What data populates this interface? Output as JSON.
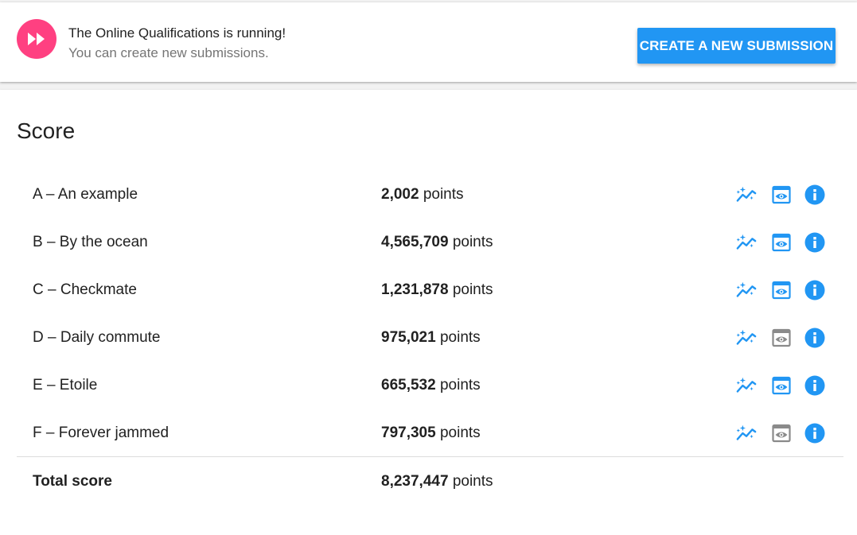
{
  "banner": {
    "title": "The Online Qualifications is running!",
    "subtitle": "You can create new submissions.",
    "icon": "fast-forward-icon",
    "create_button_label": "CREATE A NEW SUBMISSION"
  },
  "colors": {
    "accent": "#2196f3",
    "banner_icon_bg": "#ff4081",
    "view_disabled": "#8a8a8a"
  },
  "score": {
    "title": "Score",
    "unit": "points",
    "rows": [
      {
        "name": "A – An example",
        "score": "2,002",
        "view_enabled": true
      },
      {
        "name": "B – By the ocean",
        "score": "4,565,709",
        "view_enabled": true
      },
      {
        "name": "C – Checkmate",
        "score": "1,231,878",
        "view_enabled": true
      },
      {
        "name": "D – Daily commute",
        "score": "975,021",
        "view_enabled": false
      },
      {
        "name": "E – Etoile",
        "score": "665,532",
        "view_enabled": true
      },
      {
        "name": "F – Forever jammed",
        "score": "797,305",
        "view_enabled": false
      }
    ],
    "total_label": "Total score",
    "total_score": "8,237,447"
  }
}
